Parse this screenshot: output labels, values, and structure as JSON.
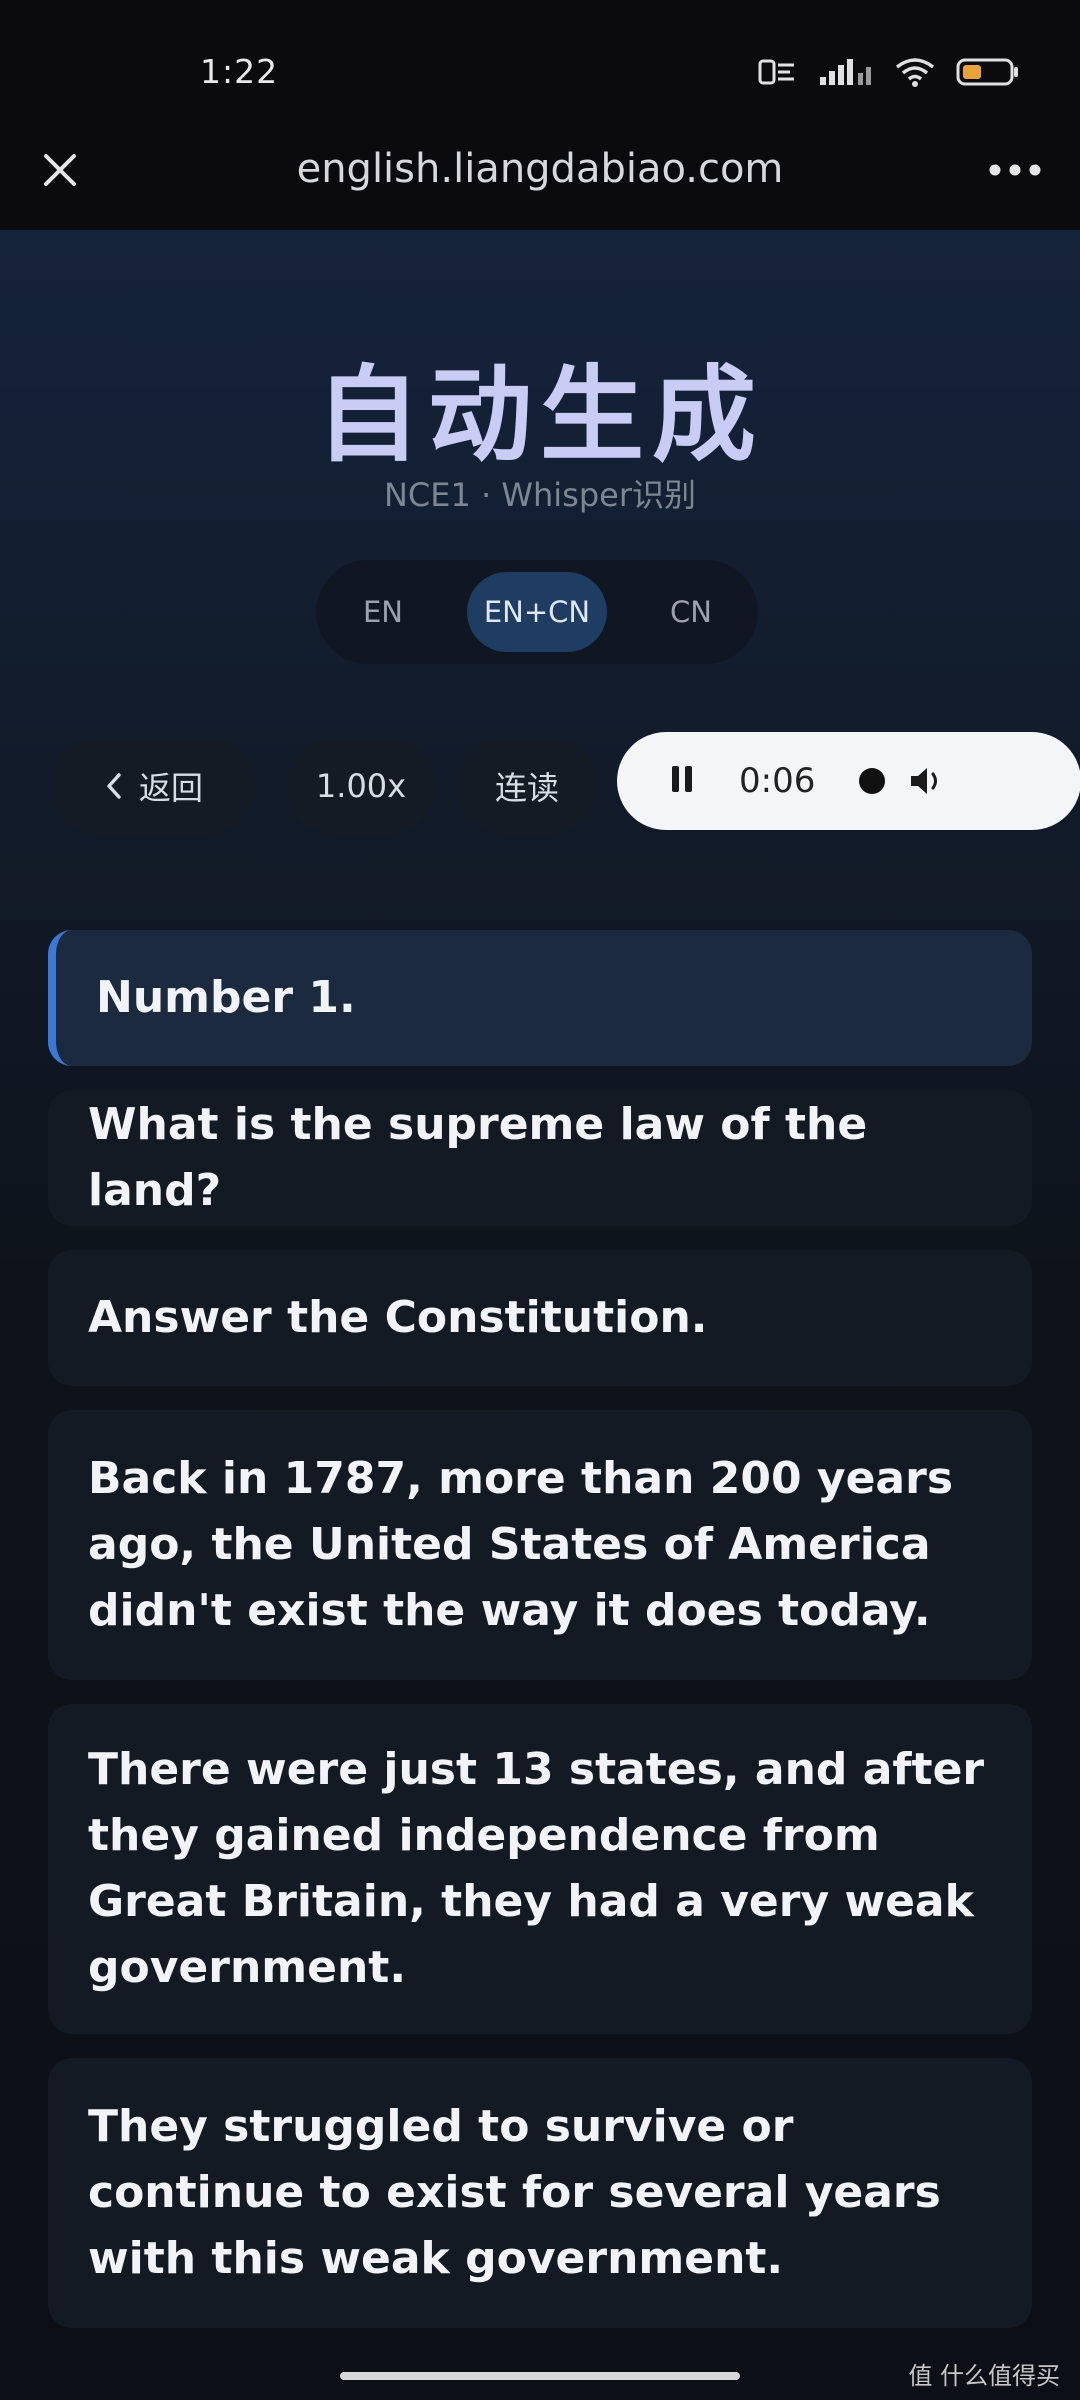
{
  "status_bar": {
    "time": "1:22"
  },
  "browser": {
    "url": "english.liangdabiao.com"
  },
  "page": {
    "title": "自动生成",
    "subtitle": "NCE1 · Whisper识别"
  },
  "lang_toggle": {
    "options": [
      "EN",
      "EN+CN",
      "CN"
    ],
    "selected": "EN+CN"
  },
  "controls": {
    "back_label": "返回",
    "speed_label": "1.00x",
    "read_label": "连读"
  },
  "audio": {
    "time": "0:06",
    "state": "playing"
  },
  "transcript": {
    "sentences": [
      "Number 1.",
      "What is the supreme law of the land?",
      "Answer the Constitution.",
      "Back in 1787, more than 200 years ago, the United States of America didn't exist the way it does today.",
      "There were just 13 states, and after they gained independence from Great Britain, they had a very weak government.",
      "They struggled to survive or continue to exist for several years with this weak government."
    ],
    "active_index": 0
  },
  "watermark": {
    "text": "值 什么值得买"
  },
  "colors": {
    "accent": "#3c79d6",
    "title": "#c9cdf6",
    "toggle_selected": "#1f3d63"
  }
}
